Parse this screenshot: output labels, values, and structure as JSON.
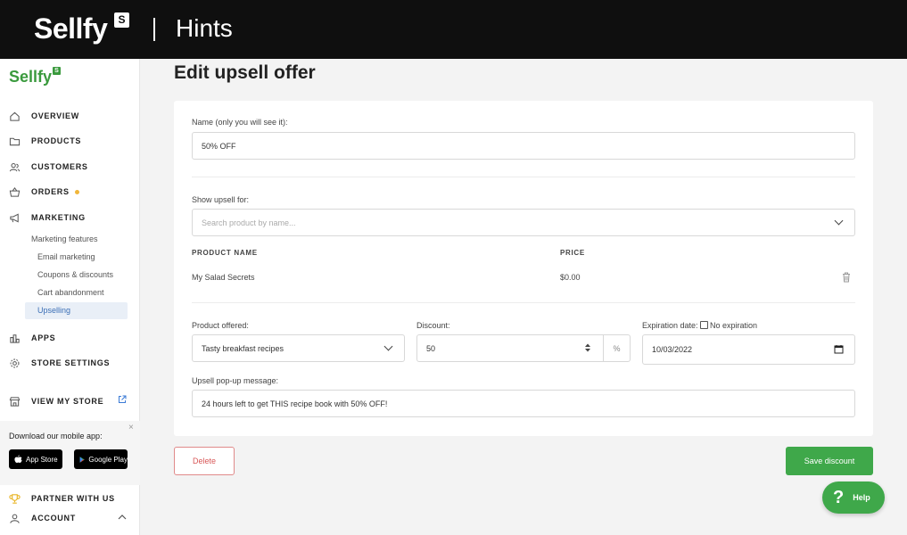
{
  "banner": {
    "brand": "Sellfy",
    "brand_badge": "S",
    "section": "Hints"
  },
  "sidebar": {
    "logo": "Sellfy",
    "logo_badge": "S",
    "nav": {
      "overview": "OVERVIEW",
      "products": "PRODUCTS",
      "customers": "CUSTOMERS",
      "orders": "ORDERS",
      "marketing": "MARKETING",
      "apps": "APPS",
      "store_settings": "STORE SETTINGS",
      "view_my_store": "VIEW MY STORE",
      "partner": "PARTNER WITH US",
      "account": "ACCOUNT"
    },
    "marketing_sub": {
      "features": "Marketing features",
      "email": "Email marketing",
      "coupons": "Coupons & discounts",
      "cart": "Cart abandonment",
      "upselling": "Upselling"
    },
    "app_promo": {
      "title": "Download our mobile app:",
      "app_store": "App Store",
      "google_play": "Google Play",
      "close": "×"
    }
  },
  "page": {
    "title": "Edit upsell offer",
    "name_label": "Name (only you will see it):",
    "name_value": "50% OFF",
    "show_for_label": "Show upsell for:",
    "search_placeholder": "Search product by name...",
    "table": {
      "headers": [
        "PRODUCT NAME",
        "PRICE"
      ],
      "rows": [
        {
          "name": "My Salad Secrets",
          "price": "$0.00"
        }
      ]
    },
    "product_offered_label": "Product offered:",
    "product_offered_value": "Tasty breakfast recipes",
    "discount_label": "Discount:",
    "discount_value": "50",
    "discount_unit": "%",
    "expiration_label": "Expiration date:",
    "no_expiration_label": "No expiration",
    "expiration_value": "10/03/2022",
    "popup_label": "Upsell pop-up message:",
    "popup_value": "24 hours left to get THIS recipe book with 50% OFF!"
  },
  "buttons": {
    "delete": "Delete",
    "save": "Save discount",
    "help": "Help",
    "help_icon": "?"
  },
  "colors": {
    "accent": "#3fa84a",
    "brand_green": "#3a9a3d",
    "danger": "#d85858",
    "header_bg": "#0f0f0f"
  }
}
